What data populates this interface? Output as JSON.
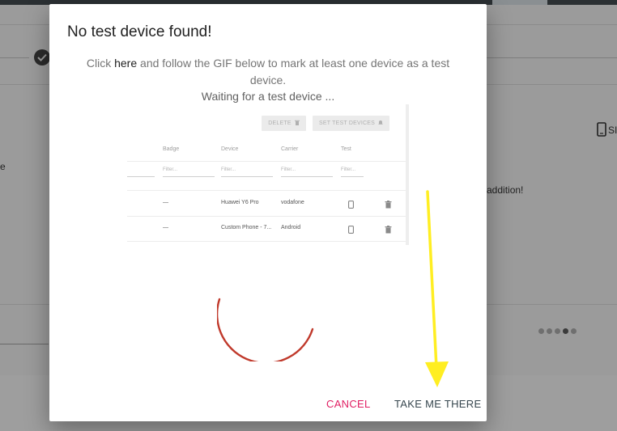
{
  "background": {
    "right_label": "SI",
    "body_fragment_left": "e",
    "body_fragment_right": "addition!"
  },
  "dialog": {
    "title": "No test device found!",
    "message_prefix": "Click ",
    "message_link": "here",
    "message_suffix": " and follow the GIF below to mark at least one device as a test device.",
    "waiting_text": "Waiting for a test device ...",
    "cancel_label": "CANCEL",
    "take_me_there_label": "TAKE ME THERE"
  },
  "gif_preview": {
    "delete_label": "DELETE",
    "set_test_devices_label": "SET TEST DEVICES",
    "columns": [
      "Badge",
      "Device",
      "Carrier",
      "Test"
    ],
    "filter_placeholder": "Filter...",
    "rows": [
      {
        "badge": "—",
        "device": "Huawei Y6 Pro",
        "carrier": "vodafone"
      },
      {
        "badge": "—",
        "device": "Custom Phone - 7...",
        "carrier": "Android"
      }
    ]
  },
  "colors": {
    "cancel": "#e01f63",
    "primary_text": "#37474f",
    "spinner": "#c0392b",
    "arrow": "#ffee22"
  },
  "icons": [
    "check-circle-icon",
    "phone-icon",
    "trash-icon",
    "bell-icon",
    "arrow-down-icon"
  ]
}
